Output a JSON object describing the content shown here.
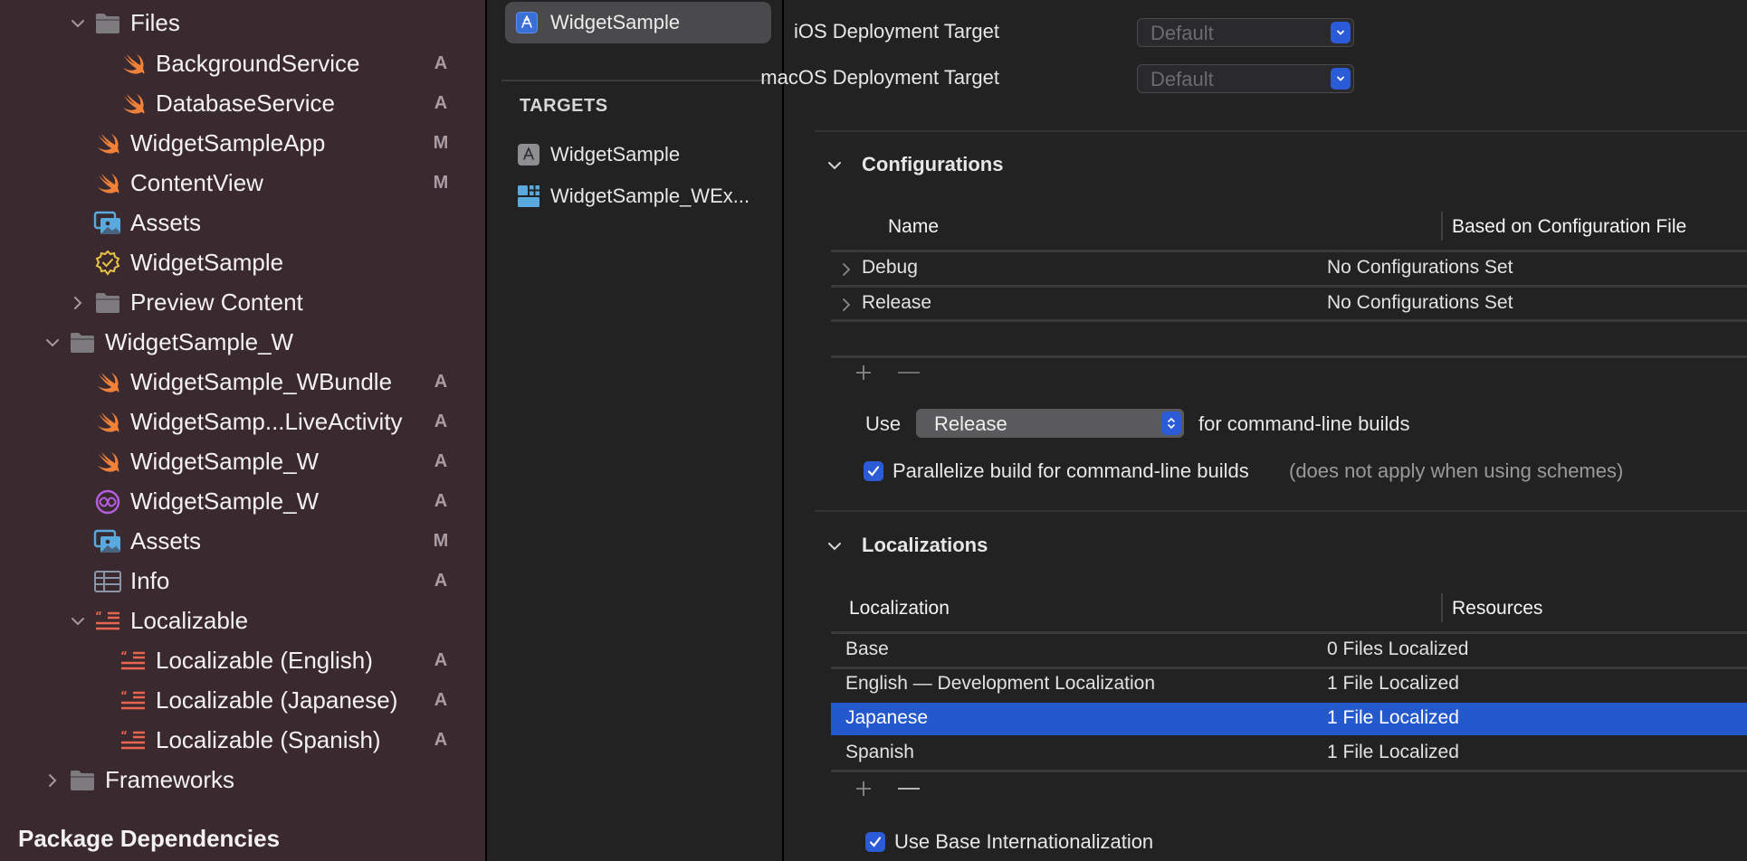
{
  "navigator": {
    "items": [
      {
        "label": "Files",
        "type": "folder",
        "expanded": true,
        "badge": ""
      },
      {
        "label": "BackgroundService",
        "type": "swift",
        "badge": "A"
      },
      {
        "label": "DatabaseService",
        "type": "swift",
        "badge": "A"
      },
      {
        "label": "WidgetSampleApp",
        "type": "swift",
        "badge": "M"
      },
      {
        "label": "ContentView",
        "type": "swift",
        "badge": "M"
      },
      {
        "label": "Assets",
        "type": "assets",
        "badge": ""
      },
      {
        "label": "WidgetSample",
        "type": "entitlements",
        "badge": ""
      },
      {
        "label": "Preview Content",
        "type": "folder",
        "expanded": false,
        "badge": ""
      },
      {
        "label": "WidgetSample_W",
        "type": "folder",
        "expanded": true,
        "badge": ""
      },
      {
        "label": "WidgetSample_WBundle",
        "type": "swift",
        "badge": "A"
      },
      {
        "label": "WidgetSamp...LiveActivity",
        "type": "swift",
        "badge": "A"
      },
      {
        "label": "WidgetSample_W",
        "type": "swift",
        "badge": "A"
      },
      {
        "label": "WidgetSample_W",
        "type": "intent",
        "badge": "A"
      },
      {
        "label": "Assets",
        "type": "assets",
        "badge": "M"
      },
      {
        "label": "Info",
        "type": "plist",
        "badge": "A"
      },
      {
        "label": "Localizable",
        "type": "strings",
        "expanded": true,
        "badge": ""
      },
      {
        "label": "Localizable (English)",
        "type": "strings",
        "badge": "A"
      },
      {
        "label": "Localizable (Japanese)",
        "type": "strings",
        "badge": "A"
      },
      {
        "label": "Localizable (Spanish)",
        "type": "strings",
        "badge": "A"
      },
      {
        "label": "Frameworks",
        "type": "folder",
        "expanded": false,
        "badge": ""
      }
    ],
    "package_dependencies_header": "Package Dependencies"
  },
  "project_panel": {
    "project_item": "WidgetSample",
    "targets_header": "TARGETS",
    "targets": [
      {
        "label": "WidgetSample",
        "icon": "app-target-icon"
      },
      {
        "label": "WidgetSample_WEx...",
        "icon": "widget-extension-icon"
      }
    ]
  },
  "editor": {
    "deployment": {
      "ios_label": "iOS Deployment Target",
      "ios_value": "Default",
      "macos_label": "macOS Deployment Target",
      "macos_value": "Default"
    },
    "configurations": {
      "title": "Configurations",
      "columns": [
        "Name",
        "Based on Configuration File"
      ],
      "rows": [
        {
          "name": "Debug",
          "file": "No Configurations Set"
        },
        {
          "name": "Release",
          "file": "No Configurations Set"
        }
      ],
      "use_label": "Use",
      "use_value": "Release",
      "use_suffix": "for command-line builds",
      "parallelize_label": "Parallelize build for command-line builds",
      "parallelize_note": "(does not apply when using schemes)",
      "parallelize_checked": true
    },
    "localizations": {
      "title": "Localizations",
      "columns": [
        "Localization",
        "Resources"
      ],
      "rows": [
        {
          "name": "Base",
          "resources": "0 Files Localized",
          "selected": false
        },
        {
          "name": "English — Development Localization",
          "resources": "1 File Localized",
          "selected": false
        },
        {
          "name": "Japanese",
          "resources": "1 File Localized",
          "selected": true
        },
        {
          "name": "Spanish",
          "resources": "1 File Localized",
          "selected": false
        }
      ],
      "base_intl_label": "Use Base Internationalization",
      "base_intl_checked": true
    }
  },
  "colors": {
    "accent": "#2b5bd6",
    "selection": "#2458cd",
    "sidebar_bg": "#3a2a30",
    "swift_orange": "#f0813a",
    "strings_red": "#e8664f",
    "entitlements_yellow": "#e9c341",
    "intent_purple": "#b55fe0",
    "assets_blue": "#5aa9de"
  }
}
